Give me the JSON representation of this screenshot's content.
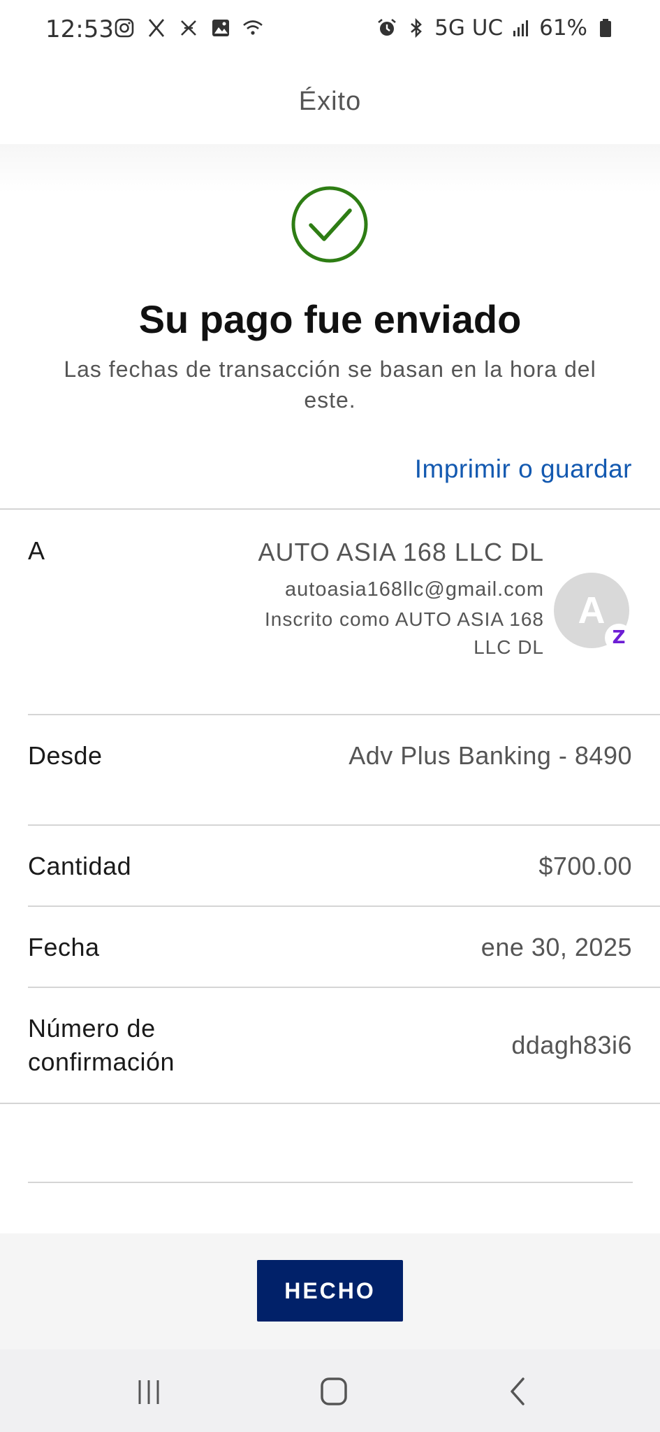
{
  "status_bar": {
    "time": "12:53",
    "network": "5G UC",
    "battery": "61%",
    "left_icons": [
      "instagram-icon",
      "x-icon",
      "sparkle-icon",
      "gallery-icon",
      "wifi-icon"
    ],
    "right_icons": [
      "alarm-icon",
      "bluetooth-icon",
      "signal-icon",
      "battery-icon"
    ]
  },
  "header": {
    "title": "Éxito"
  },
  "success": {
    "title": "Su pago fue enviado",
    "subtitle": "Las fechas de transacción se basan en la hora del este.",
    "print_link": "Imprimir o guardar",
    "check_color": "#2e7d14"
  },
  "details": {
    "to": {
      "label": "A",
      "name": "AUTO ASIA 168 LLC DL",
      "email": "autoasia168llc@gmail.com",
      "enrolled": "Inscrito como AUTO ASIA 168 LLC DL",
      "avatar_letter": "A",
      "badge": "Z"
    },
    "from": {
      "label": "Desde",
      "value": "Adv Plus Banking - 8490"
    },
    "amount": {
      "label": "Cantidad",
      "value": "$700.00"
    },
    "date": {
      "label": "Fecha",
      "value": "ene 30, 2025"
    },
    "confirmation": {
      "label": "Número de confirmación",
      "value": "ddagh83i6"
    }
  },
  "footer": {
    "done_label": "HECHO",
    "button_color": "#012169"
  },
  "nav": {
    "recent": "recent-apps-icon",
    "home": "home-icon",
    "back": "back-icon"
  }
}
